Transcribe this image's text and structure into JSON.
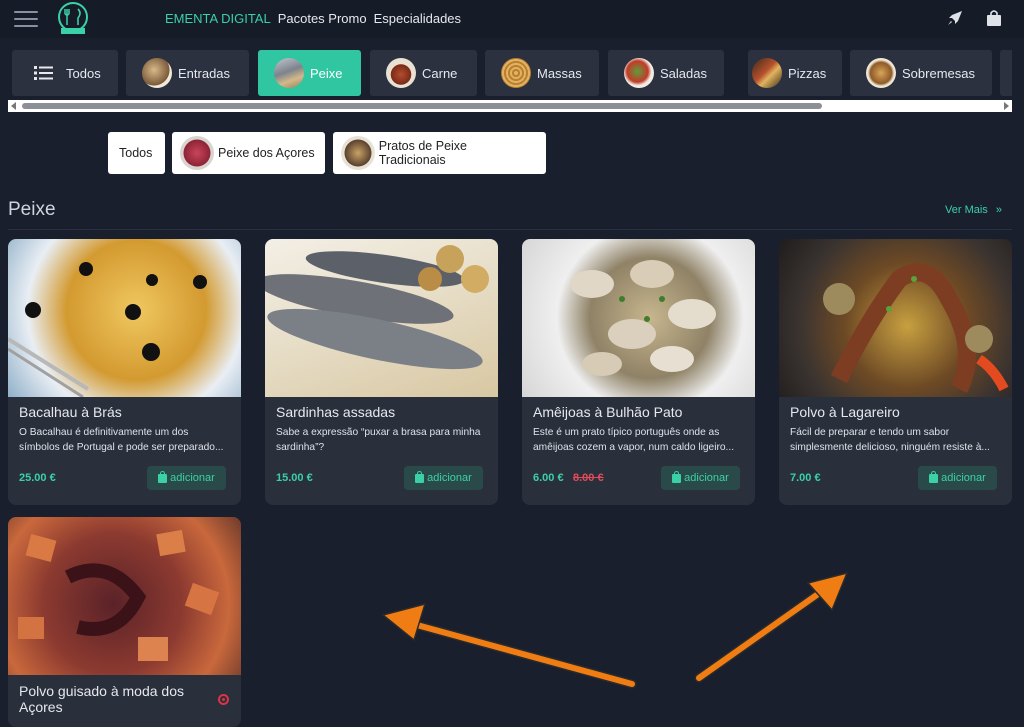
{
  "header": {
    "nav": [
      "EMENTA DIGITAL",
      "Pacotes Promo",
      "Especialidades"
    ],
    "active_index": 0,
    "icons": [
      "menu-icon",
      "rocket-icon",
      "shopping-bag-icon"
    ]
  },
  "categories": [
    {
      "label": "Todos",
      "icon": "list-icon"
    },
    {
      "label": "Entradas"
    },
    {
      "label": "Peixe",
      "active": true
    },
    {
      "label": "Carne"
    },
    {
      "label": "Massas"
    },
    {
      "label": "Saladas"
    },
    {
      "label": "Pizzas"
    },
    {
      "label": "Sobremesas"
    }
  ],
  "subcategories": [
    "Todos",
    "Peixe dos Açores",
    "Pratos de Peixe Tradicionais"
  ],
  "section": {
    "title": "Peixe",
    "more_label": "Ver Mais"
  },
  "products": [
    {
      "name": "Bacalhau à Brás",
      "description": "O Bacalhau é definitivamente um dos símbolos de Portugal e pode ser preparado...",
      "price": "25.00 €",
      "add_label": "adicionar"
    },
    {
      "name": "Sardinhas assadas",
      "description": "Sabe a expressão “puxar a brasa para minha sardinha”?",
      "price": "15.00 €",
      "add_label": "adicionar"
    },
    {
      "name": "Amêijoas à Bulhão Pato",
      "description": "Este é um prato típico português onde as amêijoas cozem a vapor, num caldo ligeiro...",
      "price": "6.00 €",
      "old_price": "8.00 €",
      "add_label": "adicionar"
    },
    {
      "name": "Polvo à Lagareiro",
      "description": "Fácil de preparar e tendo um sabor simplesmente delicioso, ninguém resiste à...",
      "price": "7.00 €",
      "add_label": "adicionar"
    },
    {
      "name": "Polvo guisado à moda dos Açores"
    }
  ],
  "colors": {
    "accent": "#2fc6a1",
    "background": "#1a1f2e",
    "card": "#2a2f3c",
    "annotation_arrow": "#f07d14"
  }
}
